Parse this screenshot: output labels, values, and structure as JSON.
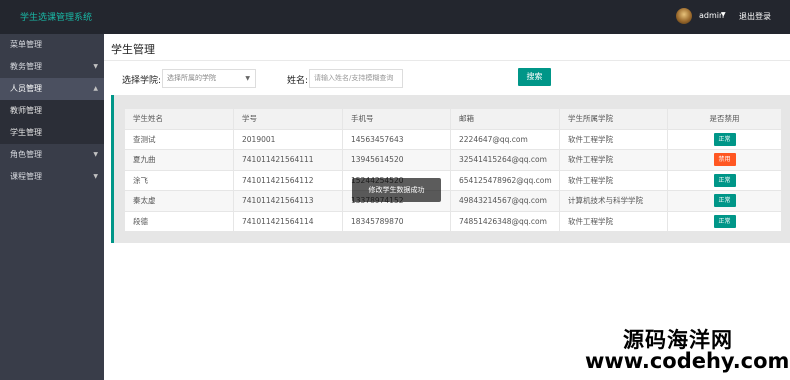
{
  "app": {
    "title": "学生选课管理系统"
  },
  "header": {
    "username": "admin",
    "logout_label": "退出登录"
  },
  "sidebar": {
    "items": [
      {
        "label": "菜单管理"
      },
      {
        "label": "教务管理"
      },
      {
        "label": "人员管理"
      },
      {
        "label": "角色管理"
      },
      {
        "label": "课程管理"
      }
    ],
    "sub_items": [
      {
        "label": "教师管理"
      },
      {
        "label": "学生管理"
      }
    ]
  },
  "page": {
    "title": "学生管理",
    "college_label": "选择学院:",
    "college_placeholder": "选择所属的学院",
    "name_label": "姓名:",
    "name_placeholder": "请输入姓名/支持模糊查询",
    "search_label": "搜索"
  },
  "table": {
    "columns": [
      "学生姓名",
      "学号",
      "手机号",
      "邮箱",
      "学生所属学院",
      "是否禁用"
    ],
    "rows": [
      {
        "name": "查测试",
        "id": "2019001",
        "phone": "14563457643",
        "email": "2224647@qq.com",
        "college": "软件工程学院",
        "status": "正常"
      },
      {
        "name": "夏九曲",
        "id": "741011421564111",
        "phone": "13945614520",
        "email": "32541415264@qq.com",
        "college": "软件工程学院",
        "status": "禁用"
      },
      {
        "name": "涂飞",
        "id": "741011421564112",
        "phone": "15244254520",
        "email": "654125478962@qq.com",
        "college": "软件工程学院",
        "status": "正常"
      },
      {
        "name": "秦太虚",
        "id": "741011421564113",
        "phone": "13378974152",
        "email": "49843214567@qq.com",
        "college": "计算机技术与科学学院",
        "status": "正常"
      },
      {
        "name": "段德",
        "id": "741011421564114",
        "phone": "18345789870",
        "email": "74851426348@qq.com",
        "college": "软件工程学院",
        "status": "正常"
      }
    ]
  },
  "toast": {
    "message": "修改学生数据成功"
  },
  "watermark": {
    "cn": "源码海洋网",
    "url": "www.codehy.com"
  },
  "colors": {
    "topbar": "#23262e",
    "sidebar": "#393d49",
    "accent": "#009688",
    "disabled": "#ff5722",
    "app_title": "#19b8a5"
  }
}
